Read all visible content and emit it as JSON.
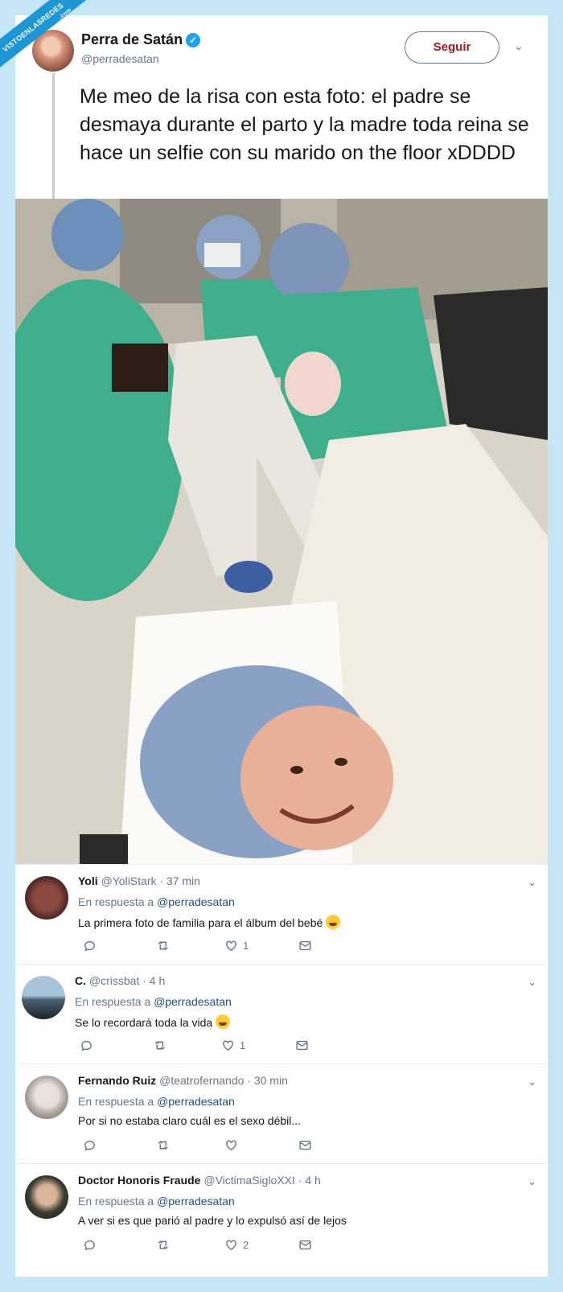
{
  "watermark": {
    "line1": "VISTOENLASREDES",
    "line2": ".com"
  },
  "tweet": {
    "name": "Perra de Satán",
    "handle": "@perradesatan",
    "follow_label": "Seguir",
    "text": "Me meo de la risa con esta foto: el padre se desmaya durante el parto y la madre toda reina se hace un selfie con su marido on the floor xDDDD"
  },
  "colors": {
    "accent": "#1da1f2",
    "link": "#1d4e89",
    "scrubs": "#3fae8c",
    "page_bg": "#c5e6f5"
  },
  "replies": [
    {
      "name": "Yoli",
      "handle": "@YoliStark",
      "time": "· 37 min",
      "in_reply_prefix": "En respuesta a",
      "in_reply_to": "@perradesatan",
      "text": "La primera foto de familia para el álbum del bebé",
      "emoji": "grinning-squint-emoji",
      "likes": "1"
    },
    {
      "name": "C.",
      "handle": "@crissbat",
      "time": "· 4 h",
      "in_reply_prefix": "En respuesta a",
      "in_reply_to": "@perradesatan",
      "text": "Se lo recordará toda la vida",
      "emoji": "tears-of-joy-emoji",
      "likes": "1"
    },
    {
      "name": "Fernando Ruiz",
      "handle": "@teatrofernando",
      "time": "· 30 min",
      "in_reply_prefix": "En respuesta a",
      "in_reply_to": "@perradesatan",
      "text": "Por si no estaba claro cuál es el sexo débil...",
      "emoji": "",
      "likes": ""
    },
    {
      "name": "Doctor Honoris Fraude",
      "handle": "@VictimaSigloXXI",
      "time": "· 4 h",
      "in_reply_prefix": "En respuesta a",
      "in_reply_to": "@perradesatan",
      "text": "A ver si es que parió al padre y lo expulsó así de lejos",
      "emoji": "",
      "likes": "2"
    }
  ]
}
